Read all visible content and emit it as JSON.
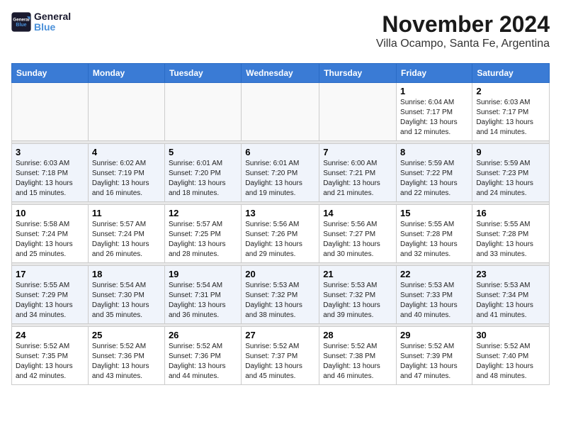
{
  "logo": {
    "line1": "General",
    "line2": "Blue"
  },
  "title": "November 2024",
  "location": "Villa Ocampo, Santa Fe, Argentina",
  "headers": [
    "Sunday",
    "Monday",
    "Tuesday",
    "Wednesday",
    "Thursday",
    "Friday",
    "Saturday"
  ],
  "weeks": [
    [
      {
        "day": "",
        "info": ""
      },
      {
        "day": "",
        "info": ""
      },
      {
        "day": "",
        "info": ""
      },
      {
        "day": "",
        "info": ""
      },
      {
        "day": "",
        "info": ""
      },
      {
        "day": "1",
        "info": "Sunrise: 6:04 AM\nSunset: 7:17 PM\nDaylight: 13 hours\nand 12 minutes."
      },
      {
        "day": "2",
        "info": "Sunrise: 6:03 AM\nSunset: 7:17 PM\nDaylight: 13 hours\nand 14 minutes."
      }
    ],
    [
      {
        "day": "3",
        "info": "Sunrise: 6:03 AM\nSunset: 7:18 PM\nDaylight: 13 hours\nand 15 minutes."
      },
      {
        "day": "4",
        "info": "Sunrise: 6:02 AM\nSunset: 7:19 PM\nDaylight: 13 hours\nand 16 minutes."
      },
      {
        "day": "5",
        "info": "Sunrise: 6:01 AM\nSunset: 7:20 PM\nDaylight: 13 hours\nand 18 minutes."
      },
      {
        "day": "6",
        "info": "Sunrise: 6:01 AM\nSunset: 7:20 PM\nDaylight: 13 hours\nand 19 minutes."
      },
      {
        "day": "7",
        "info": "Sunrise: 6:00 AM\nSunset: 7:21 PM\nDaylight: 13 hours\nand 21 minutes."
      },
      {
        "day": "8",
        "info": "Sunrise: 5:59 AM\nSunset: 7:22 PM\nDaylight: 13 hours\nand 22 minutes."
      },
      {
        "day": "9",
        "info": "Sunrise: 5:59 AM\nSunset: 7:23 PM\nDaylight: 13 hours\nand 24 minutes."
      }
    ],
    [
      {
        "day": "10",
        "info": "Sunrise: 5:58 AM\nSunset: 7:24 PM\nDaylight: 13 hours\nand 25 minutes."
      },
      {
        "day": "11",
        "info": "Sunrise: 5:57 AM\nSunset: 7:24 PM\nDaylight: 13 hours\nand 26 minutes."
      },
      {
        "day": "12",
        "info": "Sunrise: 5:57 AM\nSunset: 7:25 PM\nDaylight: 13 hours\nand 28 minutes."
      },
      {
        "day": "13",
        "info": "Sunrise: 5:56 AM\nSunset: 7:26 PM\nDaylight: 13 hours\nand 29 minutes."
      },
      {
        "day": "14",
        "info": "Sunrise: 5:56 AM\nSunset: 7:27 PM\nDaylight: 13 hours\nand 30 minutes."
      },
      {
        "day": "15",
        "info": "Sunrise: 5:55 AM\nSunset: 7:28 PM\nDaylight: 13 hours\nand 32 minutes."
      },
      {
        "day": "16",
        "info": "Sunrise: 5:55 AM\nSunset: 7:28 PM\nDaylight: 13 hours\nand 33 minutes."
      }
    ],
    [
      {
        "day": "17",
        "info": "Sunrise: 5:55 AM\nSunset: 7:29 PM\nDaylight: 13 hours\nand 34 minutes."
      },
      {
        "day": "18",
        "info": "Sunrise: 5:54 AM\nSunset: 7:30 PM\nDaylight: 13 hours\nand 35 minutes."
      },
      {
        "day": "19",
        "info": "Sunrise: 5:54 AM\nSunset: 7:31 PM\nDaylight: 13 hours\nand 36 minutes."
      },
      {
        "day": "20",
        "info": "Sunrise: 5:53 AM\nSunset: 7:32 PM\nDaylight: 13 hours\nand 38 minutes."
      },
      {
        "day": "21",
        "info": "Sunrise: 5:53 AM\nSunset: 7:32 PM\nDaylight: 13 hours\nand 39 minutes."
      },
      {
        "day": "22",
        "info": "Sunrise: 5:53 AM\nSunset: 7:33 PM\nDaylight: 13 hours\nand 40 minutes."
      },
      {
        "day": "23",
        "info": "Sunrise: 5:53 AM\nSunset: 7:34 PM\nDaylight: 13 hours\nand 41 minutes."
      }
    ],
    [
      {
        "day": "24",
        "info": "Sunrise: 5:52 AM\nSunset: 7:35 PM\nDaylight: 13 hours\nand 42 minutes."
      },
      {
        "day": "25",
        "info": "Sunrise: 5:52 AM\nSunset: 7:36 PM\nDaylight: 13 hours\nand 43 minutes."
      },
      {
        "day": "26",
        "info": "Sunrise: 5:52 AM\nSunset: 7:36 PM\nDaylight: 13 hours\nand 44 minutes."
      },
      {
        "day": "27",
        "info": "Sunrise: 5:52 AM\nSunset: 7:37 PM\nDaylight: 13 hours\nand 45 minutes."
      },
      {
        "day": "28",
        "info": "Sunrise: 5:52 AM\nSunset: 7:38 PM\nDaylight: 13 hours\nand 46 minutes."
      },
      {
        "day": "29",
        "info": "Sunrise: 5:52 AM\nSunset: 7:39 PM\nDaylight: 13 hours\nand 47 minutes."
      },
      {
        "day": "30",
        "info": "Sunrise: 5:52 AM\nSunset: 7:40 PM\nDaylight: 13 hours\nand 48 minutes."
      }
    ]
  ]
}
